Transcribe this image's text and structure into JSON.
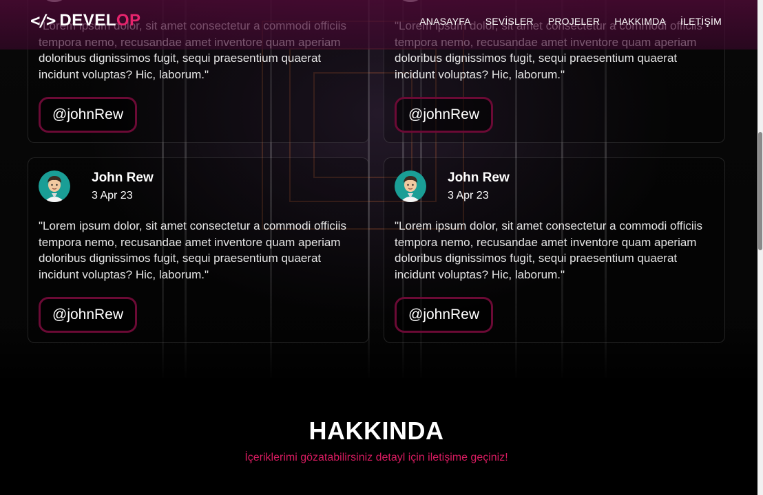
{
  "nav": {
    "logo_main": "DEVEL",
    "logo_accent": "OP",
    "items": [
      {
        "label": "ANASAYFA"
      },
      {
        "label": "SEVİSLER"
      },
      {
        "label": "PROJELER"
      },
      {
        "label": "HAKKIMDA"
      },
      {
        "label": "İLETİŞİM"
      }
    ]
  },
  "testimonials": [
    {
      "name": "",
      "date": "",
      "quote": "\"Lorem ipsum dolor, sit amet consectetur a commodi officiis tempora nemo, recusandae amet inventore quam aperiam doloribus dignissimos fugit, sequi praesentium quaerat incidunt voluptas? Hic, laborum.\"",
      "handle": "@johnRew"
    },
    {
      "name": "",
      "date": "",
      "quote": "\"Lorem ipsum dolor, sit amet consectetur a commodi officiis tempora nemo, recusandae amet inventore quam aperiam doloribus dignissimos fugit, sequi praesentium quaerat incidunt voluptas? Hic, laborum.\"",
      "handle": "@johnRew"
    },
    {
      "name": "John Rew",
      "date": "3 Apr 23",
      "quote": "\"Lorem ipsum dolor, sit amet consectetur a commodi officiis tempora nemo, recusandae amet inventore quam aperiam doloribus dignissimos fugit, sequi praesentium quaerat incidunt voluptas? Hic, laborum.\"",
      "handle": "@johnRew"
    },
    {
      "name": "John Rew",
      "date": "3 Apr 23",
      "quote": "\"Lorem ipsum dolor, sit amet consectetur a commodi officiis tempora nemo, recusandae amet inventore quam aperiam doloribus dignissimos fugit, sequi praesentium quaerat incidunt voluptas? Hic, laborum.\"",
      "handle": "@johnRew"
    }
  ],
  "about": {
    "title": "HAKKINDA",
    "subtitle": "İçeriklerimi gözatabilirsiniz detayl için iletişime geçiniz!"
  },
  "icons": {
    "logo": "code-brackets-icon",
    "avatar": "avatar-icon"
  },
  "colors": {
    "accent": "#e6246d",
    "subtitle": "#d81b60",
    "handle_border": "#6b0a35",
    "avatar_bg": "#1a9e96"
  }
}
